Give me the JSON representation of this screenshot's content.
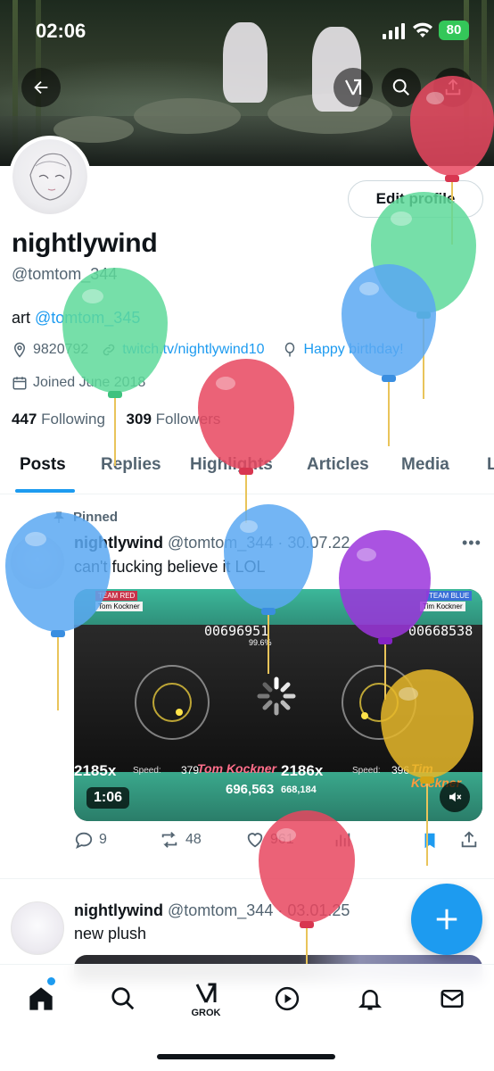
{
  "status_bar": {
    "time": "02:06",
    "battery": "80"
  },
  "profile": {
    "display_name": "nightlywind",
    "handle": "@tomtom_344",
    "edit_button": "Edit profile",
    "bio_prefix": "art ",
    "bio_mention": "@tomtom_345",
    "location": "9820792",
    "website": "twitch.tv/nightlywind10",
    "birthday": "Happy birthday!",
    "joined": "Joined June 2018",
    "following_count": "447",
    "following_label": "Following",
    "followers_count": "309",
    "followers_label": "Followers"
  },
  "tabs": [
    {
      "label": "Posts",
      "active": true
    },
    {
      "label": "Replies",
      "active": false
    },
    {
      "label": "Highlights",
      "active": false
    },
    {
      "label": "Articles",
      "active": false
    },
    {
      "label": "Media",
      "active": false
    },
    {
      "label": "L",
      "active": false
    }
  ],
  "pinned_label": "Pinned",
  "tweets": [
    {
      "name": "nightlywind",
      "handle": "@tomtom_344",
      "date": "· 30.07.22",
      "text": "can't fucking believe it LOL",
      "video": {
        "duration": "1:06",
        "left_team": "TEAM RED",
        "right_team": "TEAM BLUE",
        "left_player": "Tom Kockner",
        "right_player": "Tim Kockner",
        "left_score": "00696951",
        "right_score": "00668538",
        "left_acc": "99.6%",
        "left_combo": "2185x",
        "right_combo": "2186x",
        "left_total": "696,563",
        "right_total": "668,184",
        "speed_left": "379",
        "speed_right": "396"
      },
      "replies": "9",
      "reposts": "48",
      "likes": "961"
    },
    {
      "name": "nightlywind",
      "handle": "@tomtom_344",
      "date": "· 03.01.25",
      "text": "new plush"
    }
  ],
  "bottom_nav": {
    "grok_label": "GROK"
  },
  "colors": {
    "accent": "#1d9bf0",
    "text_primary": "#0f1419",
    "text_secondary": "#536471",
    "balloon_red": "#e8475f",
    "balloon_green": "#5ed99a",
    "balloon_blue": "#5aa8f2",
    "balloon_purple": "#9b35dc",
    "balloon_yellow": "#e8b92a"
  }
}
